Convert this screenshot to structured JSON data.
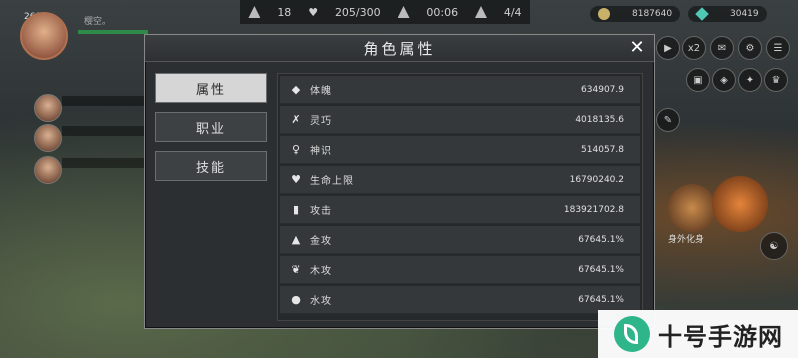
{
  "hud": {
    "level": "268",
    "player_name": "樱空。",
    "top_count": "18",
    "top_progress": "205/300",
    "timer": "00:06",
    "top_fraction": "4/4",
    "gold": "8187640",
    "gems": "30419",
    "speed_label": "x2",
    "skill_label": "身外化身"
  },
  "dialog": {
    "title": "角色属性",
    "close_glyph": "✕",
    "tabs": [
      {
        "label": "属性",
        "active": true
      },
      {
        "label": "职业",
        "active": false
      },
      {
        "label": "技能",
        "active": false
      }
    ],
    "attributes": [
      {
        "icon": "shield-icon",
        "glyph": "◆",
        "label": "体魄",
        "value": "634907.9"
      },
      {
        "icon": "agility-icon",
        "glyph": "✗",
        "label": "灵巧",
        "value": "4018135.6"
      },
      {
        "icon": "spirit-icon",
        "glyph": "♀",
        "label": "神识",
        "value": "514057.8"
      },
      {
        "icon": "heart-icon",
        "glyph": "♥",
        "label": "生命上限",
        "value": "16790240.2"
      },
      {
        "icon": "sword-icon",
        "glyph": "▮",
        "label": "攻击",
        "value": "183921702.8"
      },
      {
        "icon": "metal-icon",
        "glyph": "▲",
        "label": "金攻",
        "value": "67645.1%"
      },
      {
        "icon": "wood-icon",
        "glyph": "❦",
        "label": "木攻",
        "value": "67645.1%"
      },
      {
        "icon": "water-icon",
        "glyph": "●",
        "label": "水攻",
        "value": "67645.1%"
      }
    ]
  },
  "watermark": {
    "text": "十号手游网"
  },
  "colors": {
    "tab_active": "#d6d6d6",
    "panel": "#2b2f31",
    "row": "#34383a"
  }
}
